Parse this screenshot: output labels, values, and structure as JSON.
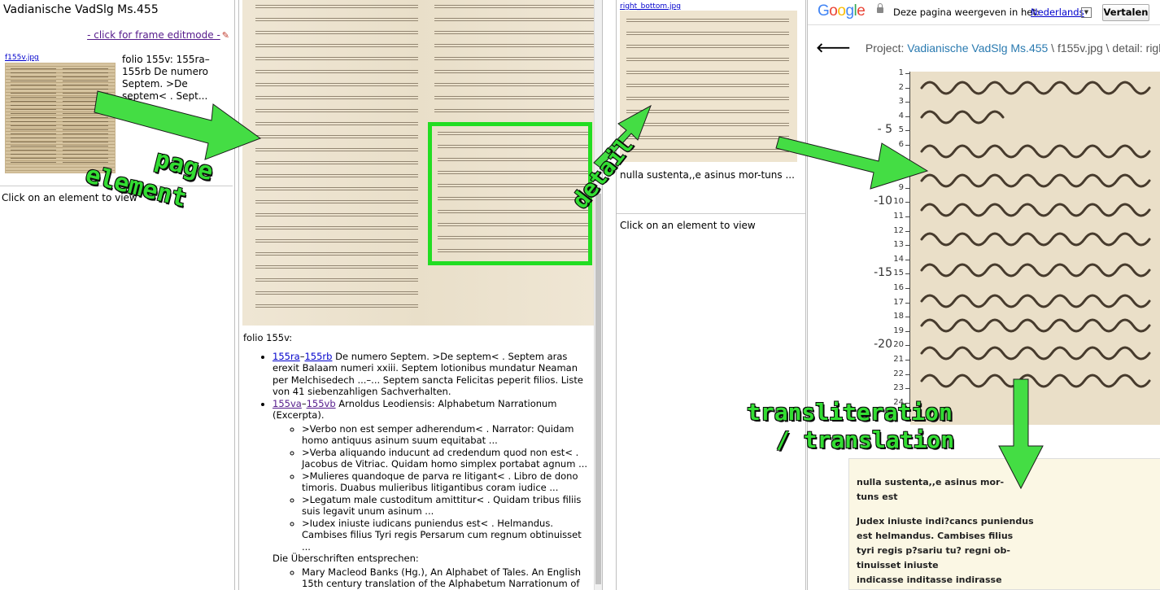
{
  "frame1": {
    "title": "Vadianische VadSlg Ms.455",
    "editmode_link": "- click for frame editmode -",
    "thumb_filename": "f155v.jpg",
    "description": "folio 155v: 155ra–155rb De numero Septem. >De septem< . Sept...",
    "click_hint": "Click on an element to view"
  },
  "frame2": {
    "heading": "folio 155v:",
    "items": [
      {
        "link_a": "155ra",
        "sep": "–",
        "link_b": "155rb",
        "text": " De numero Septem. >De septem< . Septem aras erexit Balaam numeri xxiii. Septem lotionibus mundatur Neaman per Melchisedech ...–... Septem sancta Felicitas peperit filios. Liste von 41 siebenzahligen Sachverhalten."
      },
      {
        "link_a": "155va",
        "sep": "–",
        "link_b": "155vb",
        "text": " Arnoldus Leodiensis: Alphabetum Narrationum (Excerpta).",
        "subitems": [
          ">Verbo non est semper adherendum< . Narrator: Quidam homo antiquus asinum suum equitabat ...",
          ">Verba aliquando inducunt ad credendum quod non est< . Jacobus de Vitriac. Quidam homo simplex portabat agnum ...",
          ">Mulieres quandoque de parva re litigant< . Libro de dono timoris. Duabus mulieribus litigantibus coram iudice ...",
          ">Legatum male custoditum amittitur< . Quidam tribus filiis suis legavit unum asinum ...",
          ">Iudex iniuste iudicans puniendus est< . Helmandus. Cambises filius Tyri regis Persarum cum regnum obtinuisset ..."
        ],
        "after": "Die Überschriften entsprechen:",
        "subitems2": [
          "Mary Macleod Banks (Hg.), An Alphabet of Tales. An English 15th century translation of the Alphabetum Narrationum of"
        ]
      }
    ]
  },
  "frame3": {
    "filename": "right_bottom.jpg",
    "caption": "nulla sustenta,,e asinus mor-tuns ...",
    "click_hint": "Click on an element to view"
  },
  "frame4": {
    "google_bar": {
      "logo": "Google",
      "message": "Deze pagina weergeven in het:",
      "language": "Nederlands",
      "translate_button": "Vertalen"
    },
    "breadcrumb": {
      "prefix": "Project: ",
      "project": "Vadianische VadSlg Ms.455",
      "rest": " \\ f155v.jpg \\ detail: righ"
    },
    "ruler": {
      "small_ticks": [
        "1",
        "2",
        "3",
        "4",
        "5",
        "6",
        "7",
        "8",
        "9",
        "10",
        "11",
        "12",
        "13",
        "14",
        "15",
        "16",
        "17",
        "18",
        "19",
        "20",
        "21",
        "22",
        "23",
        "24"
      ],
      "big_ticks": [
        "- 5",
        "-10",
        "-15",
        "-20"
      ]
    },
    "transliteration": [
      "nulla sustenta,,e asinus mor-",
      "tuns est",
      "",
      "Judex iniuste indi?cancs puniendus",
      "est helmandus. Cambises filius",
      "tyri regis p?sariu tu? regni ob-",
      "tinuisset iniuste",
      "indicasse inditasse indirasse"
    ]
  },
  "annotations": {
    "page_element_1": "page",
    "page_element_2": "element",
    "detail": "detail",
    "translit_1": "transliteration",
    "translit_2": "/ translation",
    "arrow_color": "#44dd44"
  }
}
